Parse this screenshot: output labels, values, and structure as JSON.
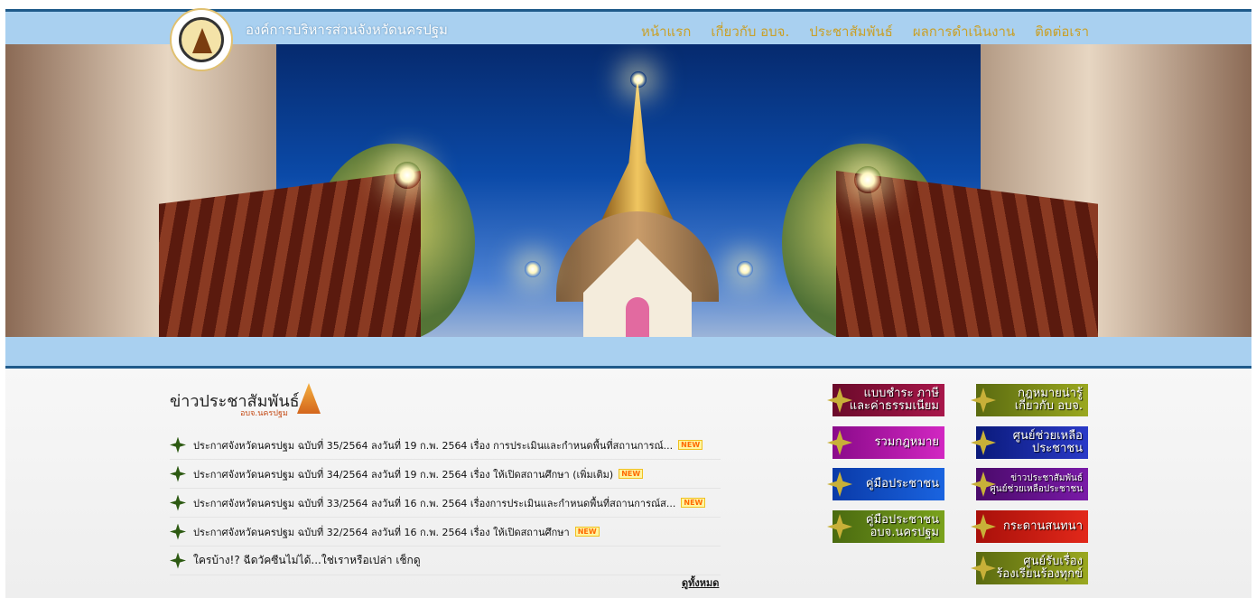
{
  "header": {
    "site_title": "องค์การบริหารส่วนจังหวัดนครปฐม",
    "menu": [
      "หน้าแรก",
      "เกี่ยวกับ อบจ.",
      "ประชาสัมพันธ์",
      "ผลการดำเนินงาน",
      "ติดต่อเรา"
    ]
  },
  "news": {
    "title": "ข่าวประชาสัมพันธ์",
    "subtitle": "อบจ.นครปฐม",
    "items": [
      {
        "text": "ประกาศจังหวัดนครปฐม ฉบับที่ 35/2564 ลงวันที่ 19 ก.พ. 2564 เรื่อง การประเมินและกำหนดพื้นที่สถานการณ์...",
        "badge": "NEW"
      },
      {
        "text": "ประกาศจังหวัดนครปฐม ฉบับที่ 34/2564 ลงวันที่ 19 ก.พ. 2564 เรื่อง ให้เปิดสถานศึกษา (เพิ่มเติม)",
        "badge": "NEW"
      },
      {
        "text": "ประกาศจังหวัดนครปฐม ฉบับที่ 33/2564 ลงวันที่ 16 ก.พ. 2564 เรื่องการประเมินและกำหนดพื้นที่สถานการณ์ส...",
        "badge": "NEW"
      },
      {
        "text": "ประกาศจังหวัดนครปฐม ฉบับที่ 32/2564 ลงวันที่ 16 ก.พ. 2564 เรื่อง ให้เปิดสถานศึกษา",
        "badge": "NEW"
      },
      {
        "text": "ใครบ้าง!? ฉีดวัคซีนไม่ได้...ใช่เราหรือเปล่า เช็กดู",
        "badge": ""
      }
    ],
    "see_all": "ดูทั้งหมด"
  },
  "quick_links_left": [
    {
      "label": "แบบชำระ ภาษี\nและค่าธรรมเนียม",
      "color": "maroon"
    },
    {
      "label": "รวมกฎหมาย",
      "color": "magenta"
    },
    {
      "label": "คู่มือประชาชน",
      "color": "blue"
    },
    {
      "label": "คู่มือประชาชน\nอบจ.นครปฐม",
      "color": "green"
    }
  ],
  "quick_links_right": [
    {
      "label": "กฎหมายน่ารู้\nเกี่ยวกับ อบจ.",
      "color": "olive"
    },
    {
      "label": "ศูนย์ช่วยเหลือ\nประชาชน",
      "color": "navy"
    },
    {
      "label": "ข่าวประชาสัมพันธ์\nศูนย์ช่วยเหลือประชาชน",
      "color": "purple"
    },
    {
      "label": "กระดานสนทนา",
      "color": "red"
    },
    {
      "label": "ศูนย์รับเรื่อง\nร้องเรียนร้องทุกข์",
      "color": "olive"
    }
  ]
}
